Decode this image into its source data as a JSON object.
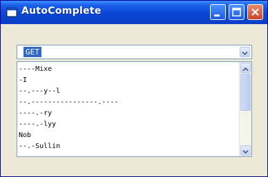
{
  "window": {
    "title": "AutoComplete",
    "icon": "app-window-icon",
    "controls": [
      "minimize-icon",
      "maximize-icon",
      "close-icon"
    ]
  },
  "combo": {
    "value": "GET  ",
    "arrow_icon": "chevron-down-icon"
  },
  "list": {
    "items": [
      "----Mixe",
      "        -I",
      "--.---y--l",
      "--.----------------.----",
      "----.-ry",
      "----.-lyy",
      "      Nob",
      "--.-Sullin"
    ]
  },
  "scrollbar": {
    "up_icon": "chevron-up-icon",
    "down_icon": "chevron-down-icon"
  },
  "colors": {
    "title_bar": "#0a46d6",
    "selection": "#316ac5",
    "window_bg": "#ece9d8",
    "close_button": "#c8452a"
  }
}
